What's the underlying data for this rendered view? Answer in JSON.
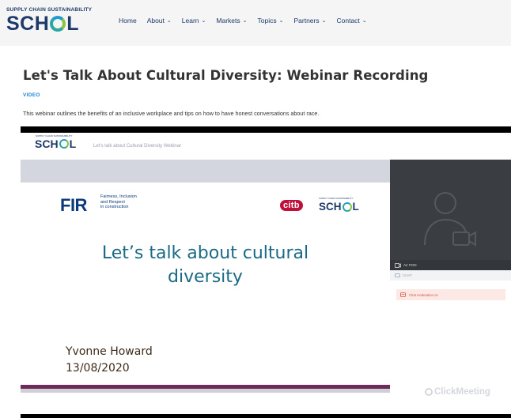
{
  "header": {
    "logo_small": "SUPPLY CHAIN SUSTAINABILITY",
    "logo_sch": "SCH",
    "logo_l": "L",
    "nav": [
      {
        "label": "Home",
        "dropdown": false
      },
      {
        "label": "About",
        "dropdown": true
      },
      {
        "label": "Learn",
        "dropdown": true
      },
      {
        "label": "Markets",
        "dropdown": true
      },
      {
        "label": "Topics",
        "dropdown": true
      },
      {
        "label": "Partners",
        "dropdown": true
      },
      {
        "label": "Contact",
        "dropdown": true
      }
    ]
  },
  "article": {
    "title": "Let's Talk About Cultural Diversity: Webinar Recording",
    "category": "VIDEO",
    "description": "This webinar outlines the benefits of an inclusive workplace and tips on how to have honest conversations about race."
  },
  "video": {
    "header_logo_small": "SUPPLY CHAIN SUSTAINABILITY",
    "header_logo_sch": "SCH",
    "header_logo_l": "L",
    "header_title": "Let's talk about Cultural Diversity Webinar",
    "slide": {
      "fir": "FIR",
      "fir_tagline": [
        "Fairness, Inclusion",
        "and Respect",
        "in construction"
      ],
      "citb": "citb",
      "logo_small": "SUPPLY CHAIN SUSTAINABILITY",
      "logo_sch": "SCH",
      "logo_l": "L",
      "heading_line1": "Let’s talk about cultural",
      "heading_line2": "diversity",
      "presenter": "Yvonne Howard",
      "date": "13/08/2020"
    },
    "panel": {
      "av_pod": "AV POD",
      "chat_tab": "CHAT",
      "chat_notice": "Chat moderation on",
      "brand": "ClickMeeting"
    }
  },
  "colors": {
    "navy": "#1d3a6b",
    "link_blue": "#1d82d6",
    "slide_teal": "#1a6a85",
    "citb_red": "#c0103a",
    "stripe_purple": "#6b2c5c"
  }
}
